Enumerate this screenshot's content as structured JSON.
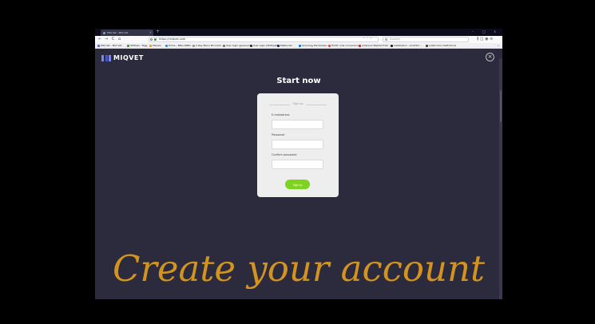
{
  "browser": {
    "tab_title": "MIQ Vet - MIQ Vet",
    "new_tab": "+",
    "window_controls": {
      "minimize": "–",
      "maximize": "□",
      "close": "×"
    },
    "nav": {
      "back": "←",
      "forward": "→",
      "reload": "C",
      "home": "⌂"
    },
    "url": "https://miqvet.com",
    "url_actions": "··· ♡ ☆",
    "search_placeholder": "Zoeken",
    "right_icons": "⫼ ◫ ◉ ≡",
    "bookmarks": [
      {
        "label": "MIQ Vet - MIQ Vet",
        "color": "#5a6ad0"
      },
      {
        "label": "SPIDael - Tagg",
        "color": "#4a8f3a"
      },
      {
        "label": "Planelo",
        "color": "#e0a020"
      },
      {
        "label": "Prime - BBA.ADBD...",
        "color": "#3e88d8"
      },
      {
        "label": "X Ray Menu Microsof...",
        "color": "#999999"
      },
      {
        "label": "User login (gerauerd)",
        "color": "#777777"
      },
      {
        "label": "User login (WiltheeM...",
        "color": "#333333"
      },
      {
        "label": "MeRoudle",
        "color": "#223366"
      },
      {
        "label": "Sociology BackGalen...",
        "color": "#2277cc"
      },
      {
        "label": "HVCE code conversion...",
        "color": "#e05050"
      },
      {
        "label": "Johannes Baptist Freit...",
        "color": "#cc3333"
      },
      {
        "label": "Installation - AcreHim...",
        "color": "#222222"
      },
      {
        "label": "Lofelt Color Definitions",
        "color": "#444444"
      }
    ],
    "bookmarks_more": "»"
  },
  "app": {
    "logo_text": "MIQVET",
    "close_symbol": "×",
    "heading": "Start now",
    "form": {
      "legend": "Sign up",
      "email_label": "E-mailadress",
      "password_label": "Password",
      "confirm_label": "Confirm password",
      "submit_label": "Sign up"
    }
  },
  "overlay_caption": "Create your account",
  "colors": {
    "page_bg": "#2c2b3d",
    "accent_green": "#7ed321",
    "logo_blue": "#7a86e8",
    "caption_gold": "#d3941f"
  }
}
